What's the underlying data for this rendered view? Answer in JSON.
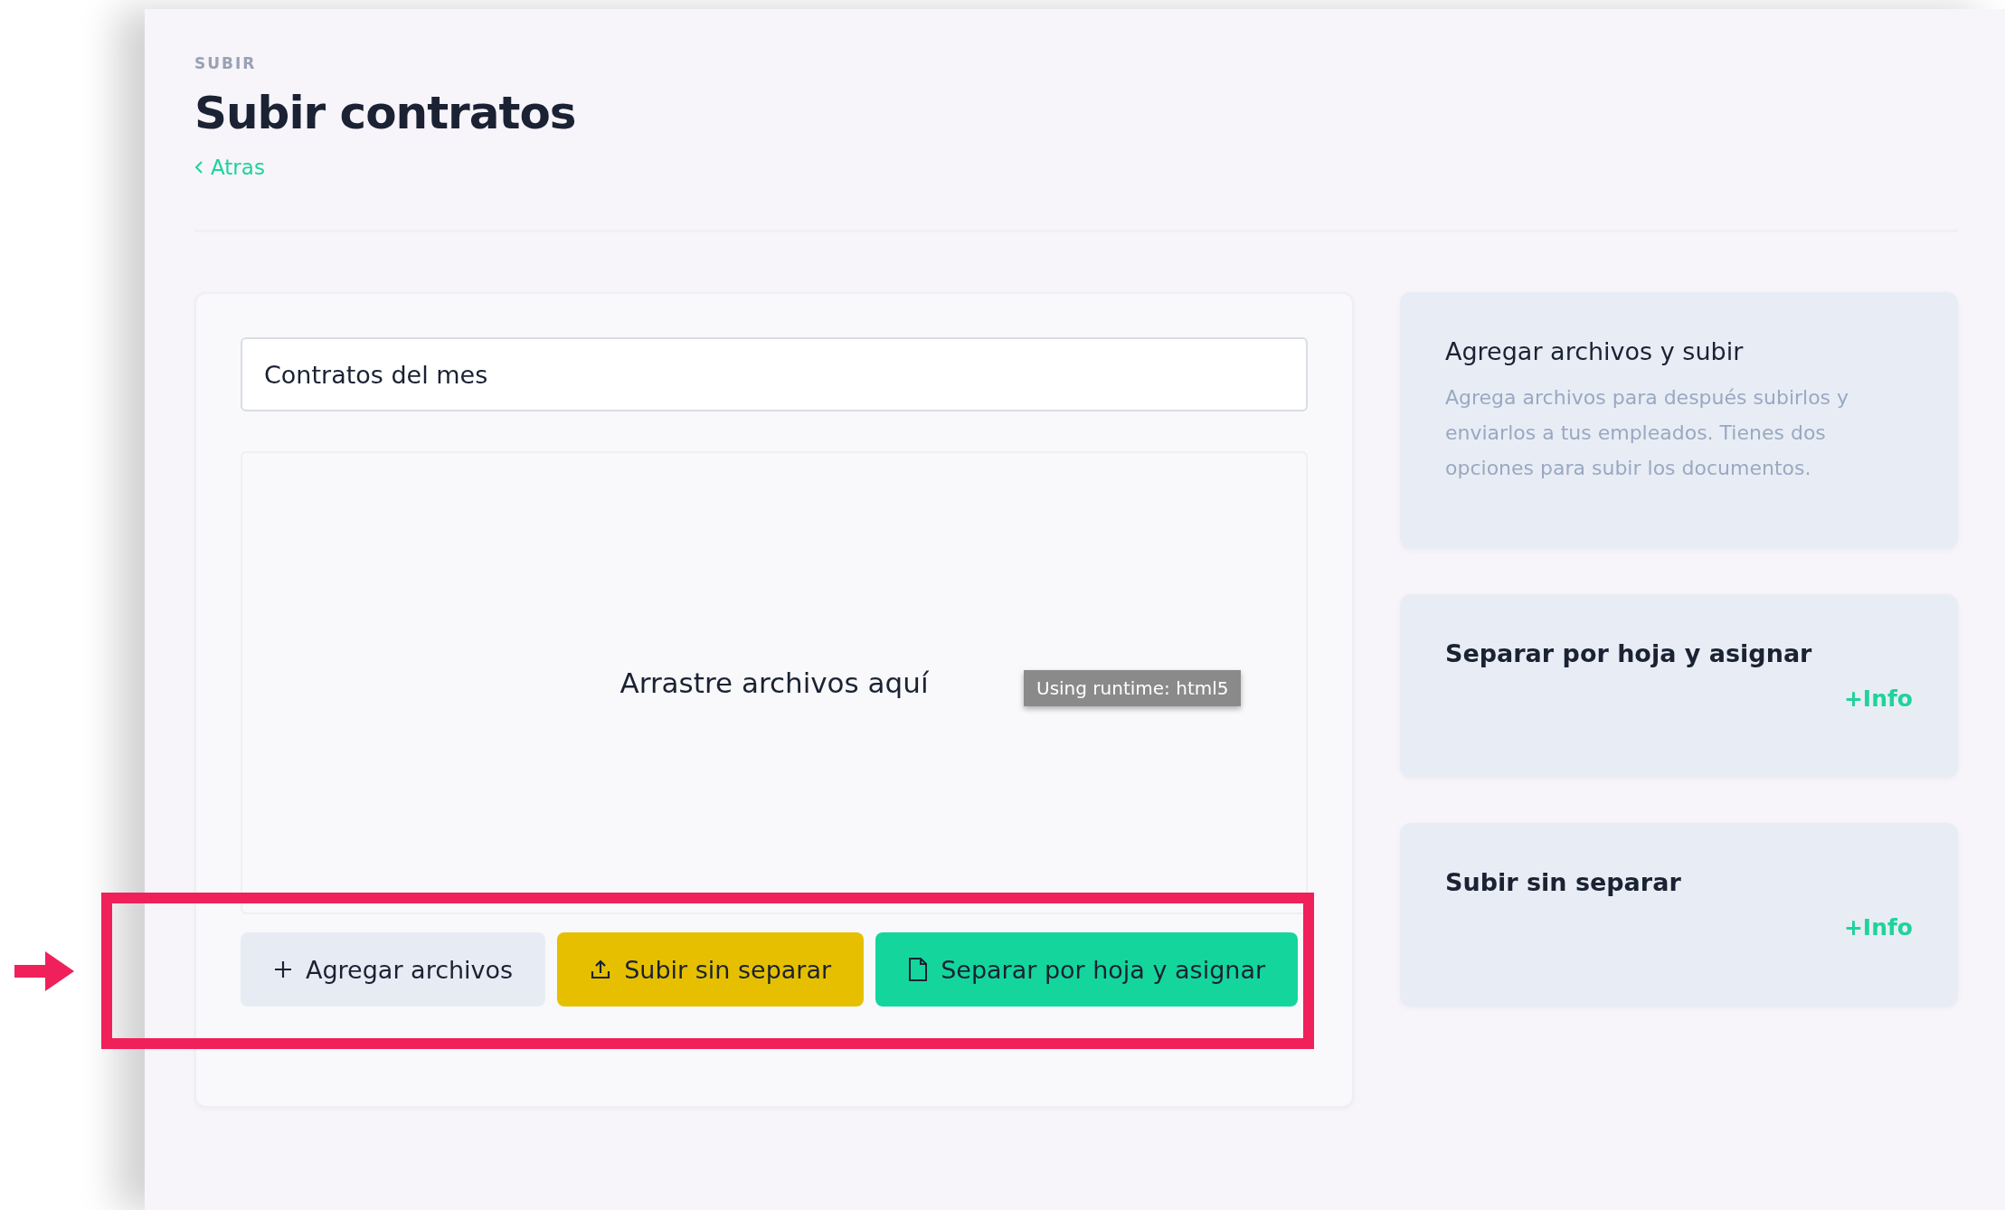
{
  "header": {
    "eyebrow": "SUBIR",
    "title": "Subir contratos",
    "back_link": "Atras"
  },
  "upload": {
    "name_field": {
      "value": "Contratos del mes"
    },
    "dropzone": {
      "prompt": "Arrastre archivos aquí",
      "runtime_tooltip": "Using runtime: html5"
    },
    "buttons": [
      {
        "kind": "secondary",
        "label": "Agregar archivos"
      },
      {
        "kind": "warning",
        "label": "Subir sin separar"
      },
      {
        "kind": "primary",
        "label": "Separar por hoja y asignar"
      }
    ]
  },
  "info_cards": [
    {
      "title": "Agregar archivos y subir",
      "description": "Agrega archivos para después subirlos y enviarlos a tus empleados. Tienes dos opciones para subir los documentos."
    },
    {
      "title": "Separar por hoja y asignar",
      "link": "+Info"
    },
    {
      "title": "Subir sin separar",
      "link": "+Info"
    }
  ]
}
